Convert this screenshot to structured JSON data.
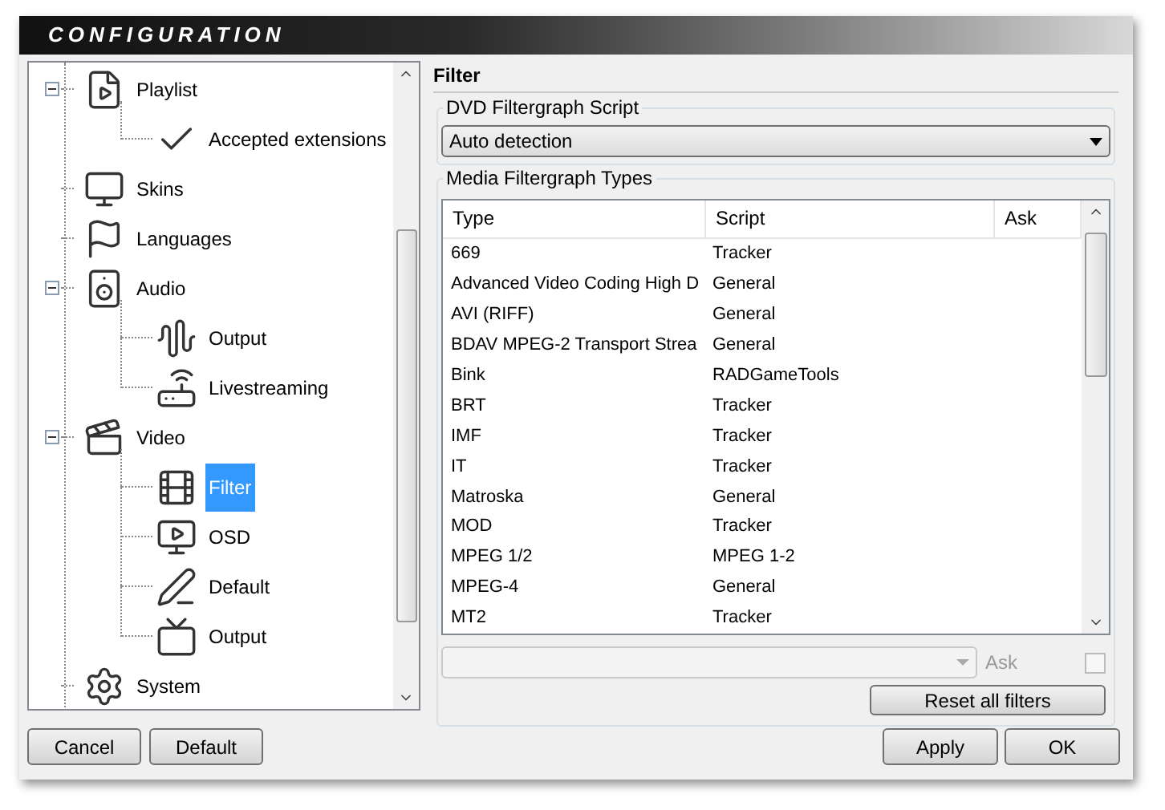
{
  "window": {
    "title": "CONFIGURATION"
  },
  "tree": [
    {
      "label": "Playlist",
      "selected": false,
      "expanded": true,
      "children": [
        {
          "label": "Accepted extensions",
          "selected": false
        }
      ]
    },
    {
      "label": "Skins",
      "selected": false
    },
    {
      "label": "Languages",
      "selected": false
    },
    {
      "label": "Audio",
      "selected": false,
      "expanded": true,
      "children": [
        {
          "label": "Output",
          "selected": false
        },
        {
          "label": "Livestreaming",
          "selected": false
        }
      ]
    },
    {
      "label": "Video",
      "selected": false,
      "expanded": true,
      "children": [
        {
          "label": "Filter",
          "selected": true
        },
        {
          "label": "OSD",
          "selected": false
        },
        {
          "label": "Default",
          "selected": false
        },
        {
          "label": "Output",
          "selected": false
        }
      ]
    },
    {
      "label": "System",
      "selected": false
    }
  ],
  "panel": {
    "title": "Filter",
    "dvd_group": {
      "label": "DVD Filtergraph Script",
      "value": "Auto detection"
    },
    "media_group": {
      "label": "Media Filtergraph Types",
      "table": {
        "columns": [
          "Type",
          "Script",
          "Ask"
        ],
        "rows": [
          [
            "669",
            "Tracker"
          ],
          [
            "Advanced Video Coding High D",
            "General"
          ],
          [
            "AVI (RIFF)",
            "General"
          ],
          [
            "BDAV MPEG-2 Transport Strea",
            "General"
          ],
          [
            "Bink",
            "RADGameTools"
          ],
          [
            "BRT",
            "Tracker"
          ],
          [
            "IMF",
            "Tracker"
          ],
          [
            "IT",
            "Tracker"
          ],
          [
            "Matroska",
            "General"
          ],
          [
            "MOD",
            "Tracker"
          ],
          [
            "MPEG 1/2",
            "MPEG 1-2"
          ],
          [
            "MPEG-4",
            "General"
          ],
          [
            "MT2",
            "Tracker"
          ]
        ]
      },
      "script_select": {
        "disabled": true
      },
      "ask": {
        "label": "Ask",
        "checked": false,
        "disabled": true
      },
      "reset_button": "Reset all filters"
    }
  },
  "buttons_left": [
    "Cancel",
    "Default"
  ],
  "buttons_right": [
    "Apply",
    "OK"
  ]
}
